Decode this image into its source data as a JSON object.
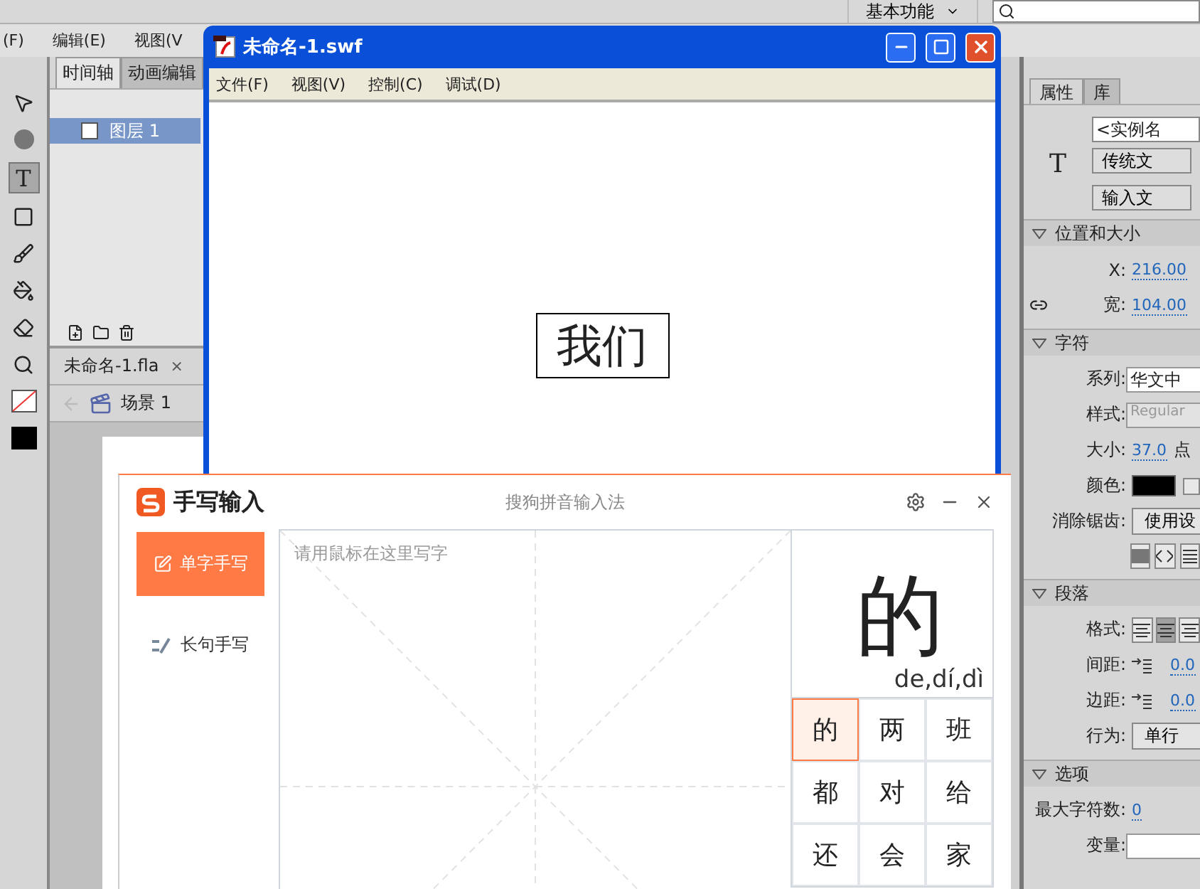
{
  "ide": {
    "workspace": "基本功能",
    "menu": [
      "(F)",
      "编辑(E)",
      "视图(V"
    ]
  },
  "tools": [
    {
      "kind": "arrow",
      "selected": false
    },
    {
      "kind": "sphere",
      "selected": false
    },
    {
      "kind": "text",
      "selected": true,
      "label": "T"
    },
    {
      "kind": "rect",
      "selected": false
    },
    {
      "kind": "brush",
      "selected": false
    },
    {
      "kind": "bucket",
      "selected": false
    },
    {
      "kind": "eraser",
      "selected": false
    },
    {
      "kind": "zoom",
      "selected": false
    },
    {
      "kind": "stroke",
      "selected": false
    },
    {
      "kind": "fill",
      "selected": false
    }
  ],
  "timeline": {
    "tabs": [
      {
        "label": "时间轴",
        "selected": true
      },
      {
        "label": "动画编辑",
        "selected": false
      }
    ],
    "layers": [
      {
        "name": "图层 1",
        "selected": true
      }
    ]
  },
  "document": {
    "tab": "未命名-1.fla",
    "close": "×",
    "scene": "场景 1"
  },
  "properties": {
    "tabs": [
      {
        "label": "属性",
        "selected": true
      },
      {
        "label": "库",
        "selected": false
      }
    ],
    "type_icon": "T",
    "instance_name": {
      "placeholder": "<实例名"
    },
    "text_type": "传统文",
    "text_mode": "输入文",
    "sections": [
      {
        "title": "位置和大小",
        "rows": [
          {
            "kind": "value",
            "label": "X:",
            "value": "216.00"
          },
          {
            "kind": "link_value",
            "label": "宽:",
            "value": "104.00"
          }
        ]
      },
      {
        "title": "字符",
        "rows": [
          {
            "kind": "field",
            "label": "系列:",
            "value": "华文中",
            "disabled": false
          },
          {
            "kind": "field",
            "label": "样式:",
            "value": "Regular",
            "disabled": true
          },
          {
            "kind": "value",
            "label": "大小:",
            "value": "37.0",
            "unit": "点"
          },
          {
            "kind": "color",
            "label": "颜色:",
            "color": "#000000",
            "checked": false
          },
          {
            "kind": "dropdown",
            "label": "消除锯齿:",
            "value": "使用设"
          },
          {
            "kind": "icons"
          }
        ]
      },
      {
        "title": "段落",
        "rows": [
          {
            "kind": "align",
            "label": "格式:",
            "buttons": [
              {
                "selected": false
              },
              {
                "selected": true
              },
              {
                "selected": false
              }
            ]
          },
          {
            "kind": "spacing",
            "label": "间距:",
            "value": "0.0"
          },
          {
            "kind": "indent",
            "label": "边距:",
            "value": "0.0"
          },
          {
            "kind": "dropdown",
            "label": "行为:",
            "value": "单行"
          }
        ]
      },
      {
        "title": "选项",
        "rows": [
          {
            "kind": "value",
            "label": "最大字符数:",
            "value": "0"
          },
          {
            "kind": "empty_field",
            "label": "变量:"
          }
        ]
      }
    ]
  },
  "swf_window": {
    "title": "未命名-1.swf",
    "menu": [
      "文件(F)",
      "视图(V)",
      "控制(C)",
      "调试(D)"
    ],
    "text": "我们"
  },
  "handwriting": {
    "title": "手写输入",
    "subtitle": "搜狗拼音输入法",
    "modes": [
      {
        "label": "单字手写",
        "selected": true
      },
      {
        "label": "长句手写",
        "selected": false
      }
    ],
    "placeholder": "请用鼠标在这里写字",
    "preview": {
      "char": "的",
      "pinyin": "de,dí,dì"
    },
    "candidates": [
      {
        "char": "的",
        "selected": true
      },
      {
        "char": "两",
        "selected": false
      },
      {
        "char": "班",
        "selected": false
      },
      {
        "char": "都",
        "selected": false
      },
      {
        "char": "对",
        "selected": false
      },
      {
        "char": "给",
        "selected": false
      },
      {
        "char": "还",
        "selected": false
      },
      {
        "char": "会",
        "selected": false
      },
      {
        "char": "家",
        "selected": false
      }
    ]
  }
}
